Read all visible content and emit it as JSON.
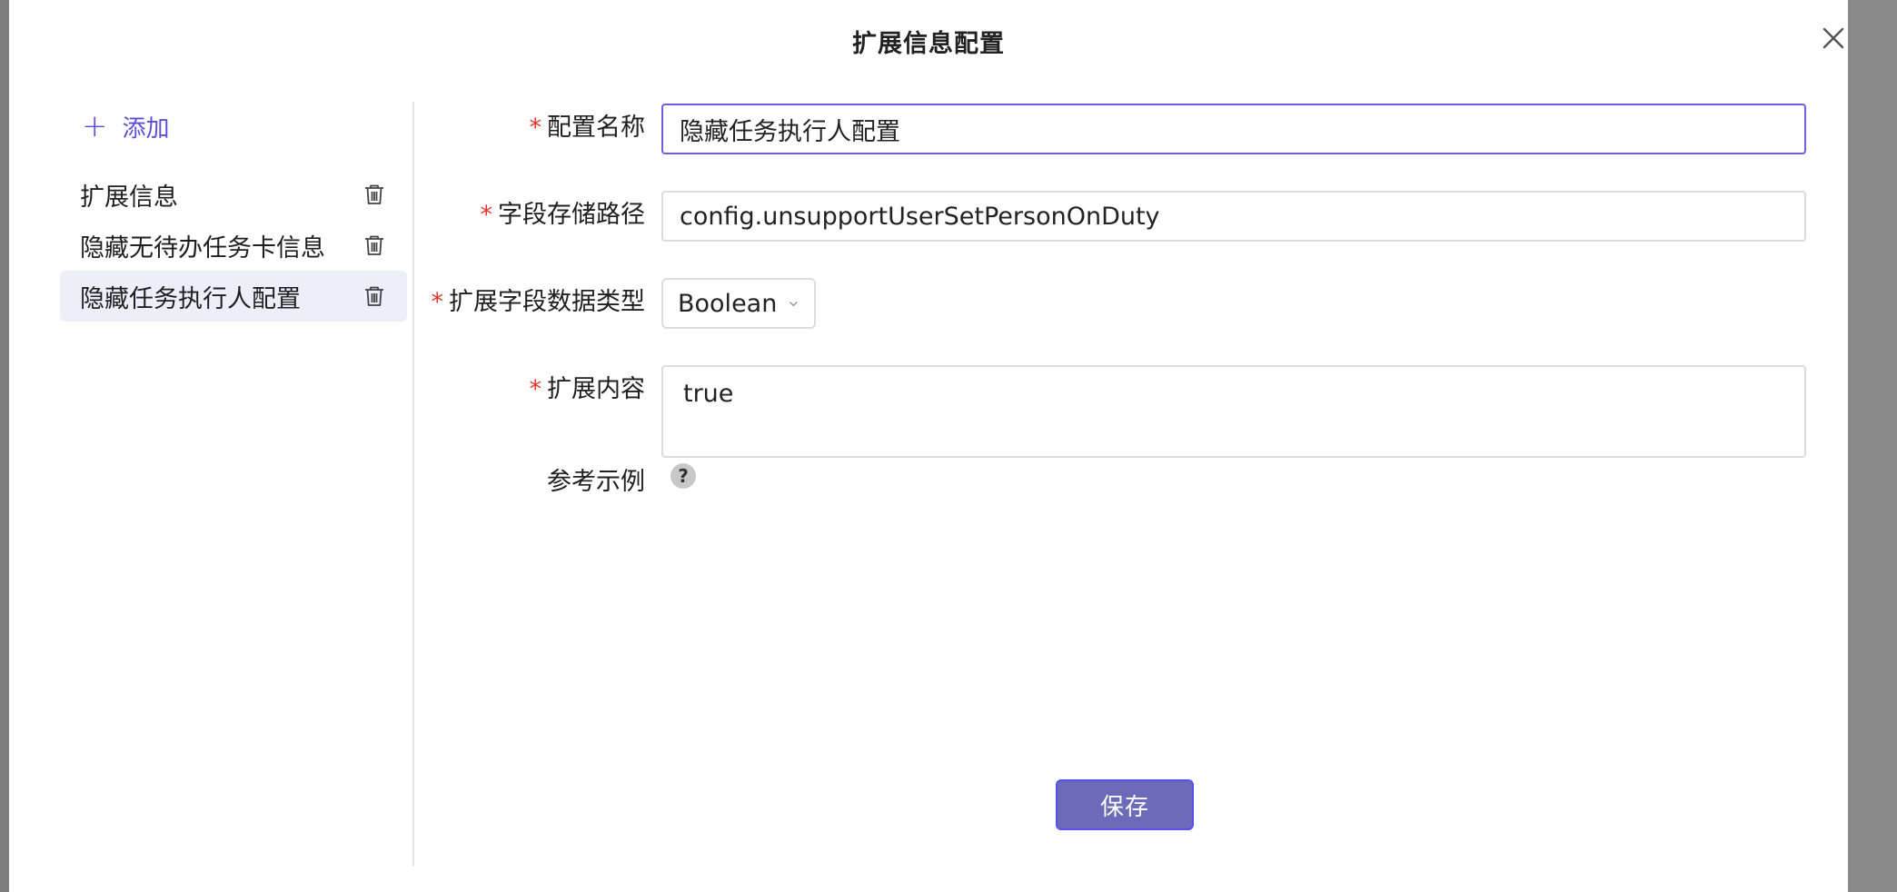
{
  "modal": {
    "title": "扩展信息配置"
  },
  "sidebar": {
    "add_label": "添加",
    "items": [
      {
        "label": "扩展信息"
      },
      {
        "label": "隐藏无待办任务卡信息"
      },
      {
        "label": "隐藏任务执行人配置",
        "active": true
      }
    ]
  },
  "form": {
    "required_mark": "*",
    "config_name": {
      "label": "配置名称",
      "value": "隐藏任务执行人配置"
    },
    "field_path": {
      "label": "字段存储路径",
      "value": "config.unsupportUserSetPersonOnDuty"
    },
    "data_type": {
      "label": "扩展字段数据类型",
      "value": "Boolean"
    },
    "content": {
      "label": "扩展内容",
      "value": "true"
    },
    "example": {
      "label": "参考示例",
      "help_glyph": "?"
    }
  },
  "footer": {
    "save_label": "保存"
  },
  "colors": {
    "accent": "#5a4fd9",
    "required": "#e0352b",
    "active_bg": "#eceff9",
    "save_bg": "#6b6bb9"
  }
}
